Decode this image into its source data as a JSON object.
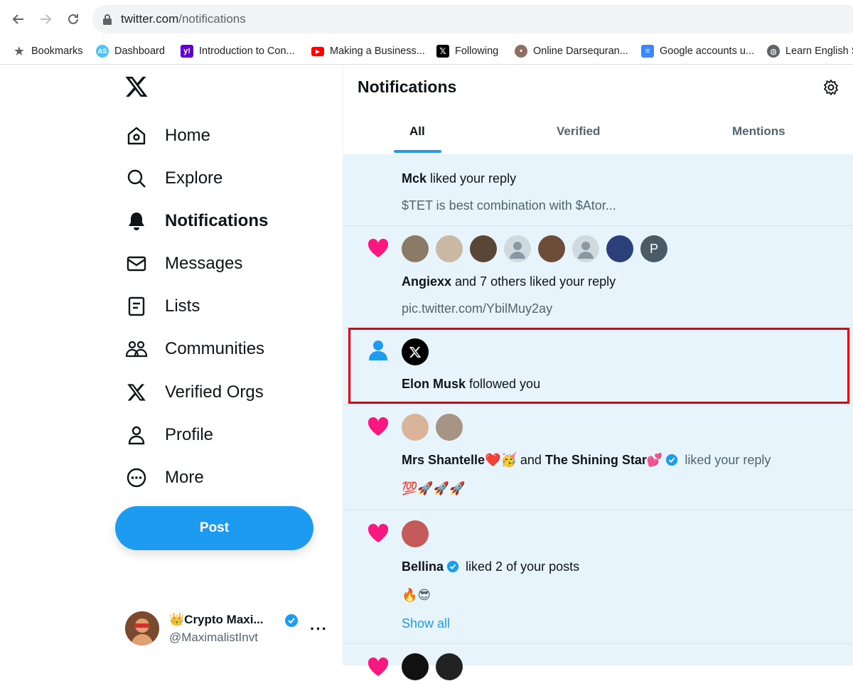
{
  "browser": {
    "url_host": "twitter.com",
    "url_path": "/notifications",
    "bookmarks": [
      {
        "label": "Bookmarks",
        "icon": "star-icon",
        "color": "#5f6368"
      },
      {
        "label": "Dashboard",
        "icon": "as-icon",
        "color": "#4fc3f7"
      },
      {
        "label": "Introduction to Con...",
        "icon": "yahoo-icon",
        "color": "#6001d2"
      },
      {
        "label": "Making a Business...",
        "icon": "youtube-icon",
        "color": "#ff0000"
      },
      {
        "label": "Following",
        "icon": "x-icon",
        "color": "#000000"
      },
      {
        "label": "Online Darsequran...",
        "icon": "site-icon",
        "color": "#8d6e63"
      },
      {
        "label": "Google accounts u...",
        "icon": "google-forms-icon",
        "color": "#4285f4"
      },
      {
        "label": "Learn English S",
        "icon": "globe-icon",
        "color": "#5f6368"
      }
    ]
  },
  "nav": {
    "items": [
      {
        "label": "Home",
        "icon": "home-icon"
      },
      {
        "label": "Explore",
        "icon": "search-icon"
      },
      {
        "label": "Notifications",
        "icon": "bell-icon",
        "active": true
      },
      {
        "label": "Messages",
        "icon": "envelope-icon"
      },
      {
        "label": "Lists",
        "icon": "list-icon"
      },
      {
        "label": "Communities",
        "icon": "communities-icon"
      },
      {
        "label": "Verified Orgs",
        "icon": "x-logo-icon"
      },
      {
        "label": "Profile",
        "icon": "person-icon"
      },
      {
        "label": "More",
        "icon": "more-circle-icon"
      }
    ],
    "post_label": "Post"
  },
  "account": {
    "name": "👑Crypto Maxi...",
    "handle": "@MaximalistInvt"
  },
  "notifications": {
    "title": "Notifications",
    "tabs": [
      "All",
      "Verified",
      "Mentions"
    ],
    "active_tab": "All",
    "items": [
      {
        "actor": "Mck",
        "action": " liked your reply",
        "preview": "$TET is best combination with $Ator..."
      },
      {
        "actor": "Angiexx",
        "action": " and 7 others liked your reply",
        "preview": "pic.twitter.com/YbilMuy2ay",
        "avatar_letter": "P"
      },
      {
        "actor": "Elon Musk",
        "action": " followed you"
      },
      {
        "actor": "Mrs Shantelle❤️🥳",
        "joiner": " and ",
        "actor2": "The Shining Star💕",
        "action": " liked your reply",
        "preview": "💯🚀🚀🚀"
      },
      {
        "actor": "Bellina",
        "action": " liked 2 of your posts",
        "preview": "🔥😎",
        "link": "Show all"
      }
    ]
  },
  "colors": {
    "accent": "#1d9bf0",
    "like": "#f91880",
    "highlight_border": "#e0000e",
    "feed_bg": "#e8f4fc"
  }
}
